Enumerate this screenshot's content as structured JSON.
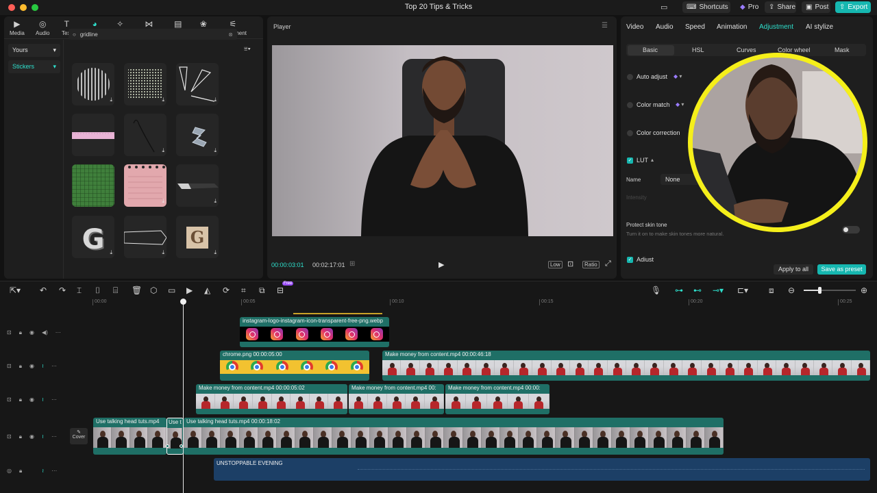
{
  "window": {
    "title": "Top 20 Tips & Tricks",
    "buttons": {
      "shortcuts": "Shortcuts",
      "pro": "Pro",
      "share": "Share",
      "post": "Post",
      "export": "Export"
    }
  },
  "left_panel": {
    "tabs": [
      {
        "label": "Media",
        "icon": "media-icon"
      },
      {
        "label": "Audio",
        "icon": "audio-icon"
      },
      {
        "label": "Text",
        "icon": "text-icon"
      },
      {
        "label": "Stickers",
        "icon": "stickers-icon",
        "active": true
      },
      {
        "label": "Effects",
        "icon": "effects-icon"
      },
      {
        "label": "Transitions",
        "icon": "transitions-icon"
      },
      {
        "label": "Captions",
        "icon": "captions-icon"
      },
      {
        "label": "Filters",
        "icon": "filters-icon"
      },
      {
        "label": "Adjustment",
        "icon": "adjustment-icon"
      }
    ],
    "category_dropdown": "Yours",
    "category_item": "Stickers",
    "search_value": "gridline",
    "sticker_letter_g": "G"
  },
  "player": {
    "title": "Player",
    "current_time": "00:00:03:01",
    "total_time": "00:02:17:01",
    "quality": "Low",
    "ratio": "Ratio"
  },
  "right_panel": {
    "tabs": [
      "Video",
      "Audio",
      "Speed",
      "Animation",
      "Adjustment",
      "AI stylize"
    ],
    "active_tab": "Adjustment",
    "subtabs": [
      "Basic",
      "HSL",
      "Curves",
      "Color wheel",
      "Mask"
    ],
    "auto_adjust": "Auto adjust",
    "color_match": "Color match",
    "color_correction": "Color correction",
    "lut": "LUT",
    "name_label": "Name",
    "name_value": "None",
    "intensity": "Intensity",
    "protect_skin": "Protect skin tone",
    "protect_skin_desc": "Turn it on to make skin tones more natural.",
    "adjust": "Adjust",
    "apply_all": "Apply to all",
    "save_preset": "Save as preset"
  },
  "timeline": {
    "free_badge": "Free",
    "ruler": [
      "00:00",
      "00:05",
      "00:10",
      "00:15",
      "00:20",
      "00:25"
    ],
    "cover": "Cover",
    "clips": {
      "instagram": "instagram-logo-instagram-icon-transparent-free-png.webp",
      "chrome": "chrome.png  00:00:05:00",
      "money_long": "Make money from content.mp4  00:00:46:18",
      "money_a": "Make money from content.mp4  00:00:05:02",
      "money_b": "Make money from content.mp4  00:",
      "money_c": "Make money from content.mp4  00:00:",
      "talk_a": "Use talking head tuts.mp4",
      "talk_b": "Use t",
      "talk_c": "Use talking head tuts.mp4  00:00:18:02",
      "audio": "UNSTOPPABLE EVENING"
    }
  },
  "colors": {
    "accent": "#2ee0cd",
    "export": "#16b7b0",
    "ring": "#f5ef1a",
    "pro": "#9a7cff"
  }
}
